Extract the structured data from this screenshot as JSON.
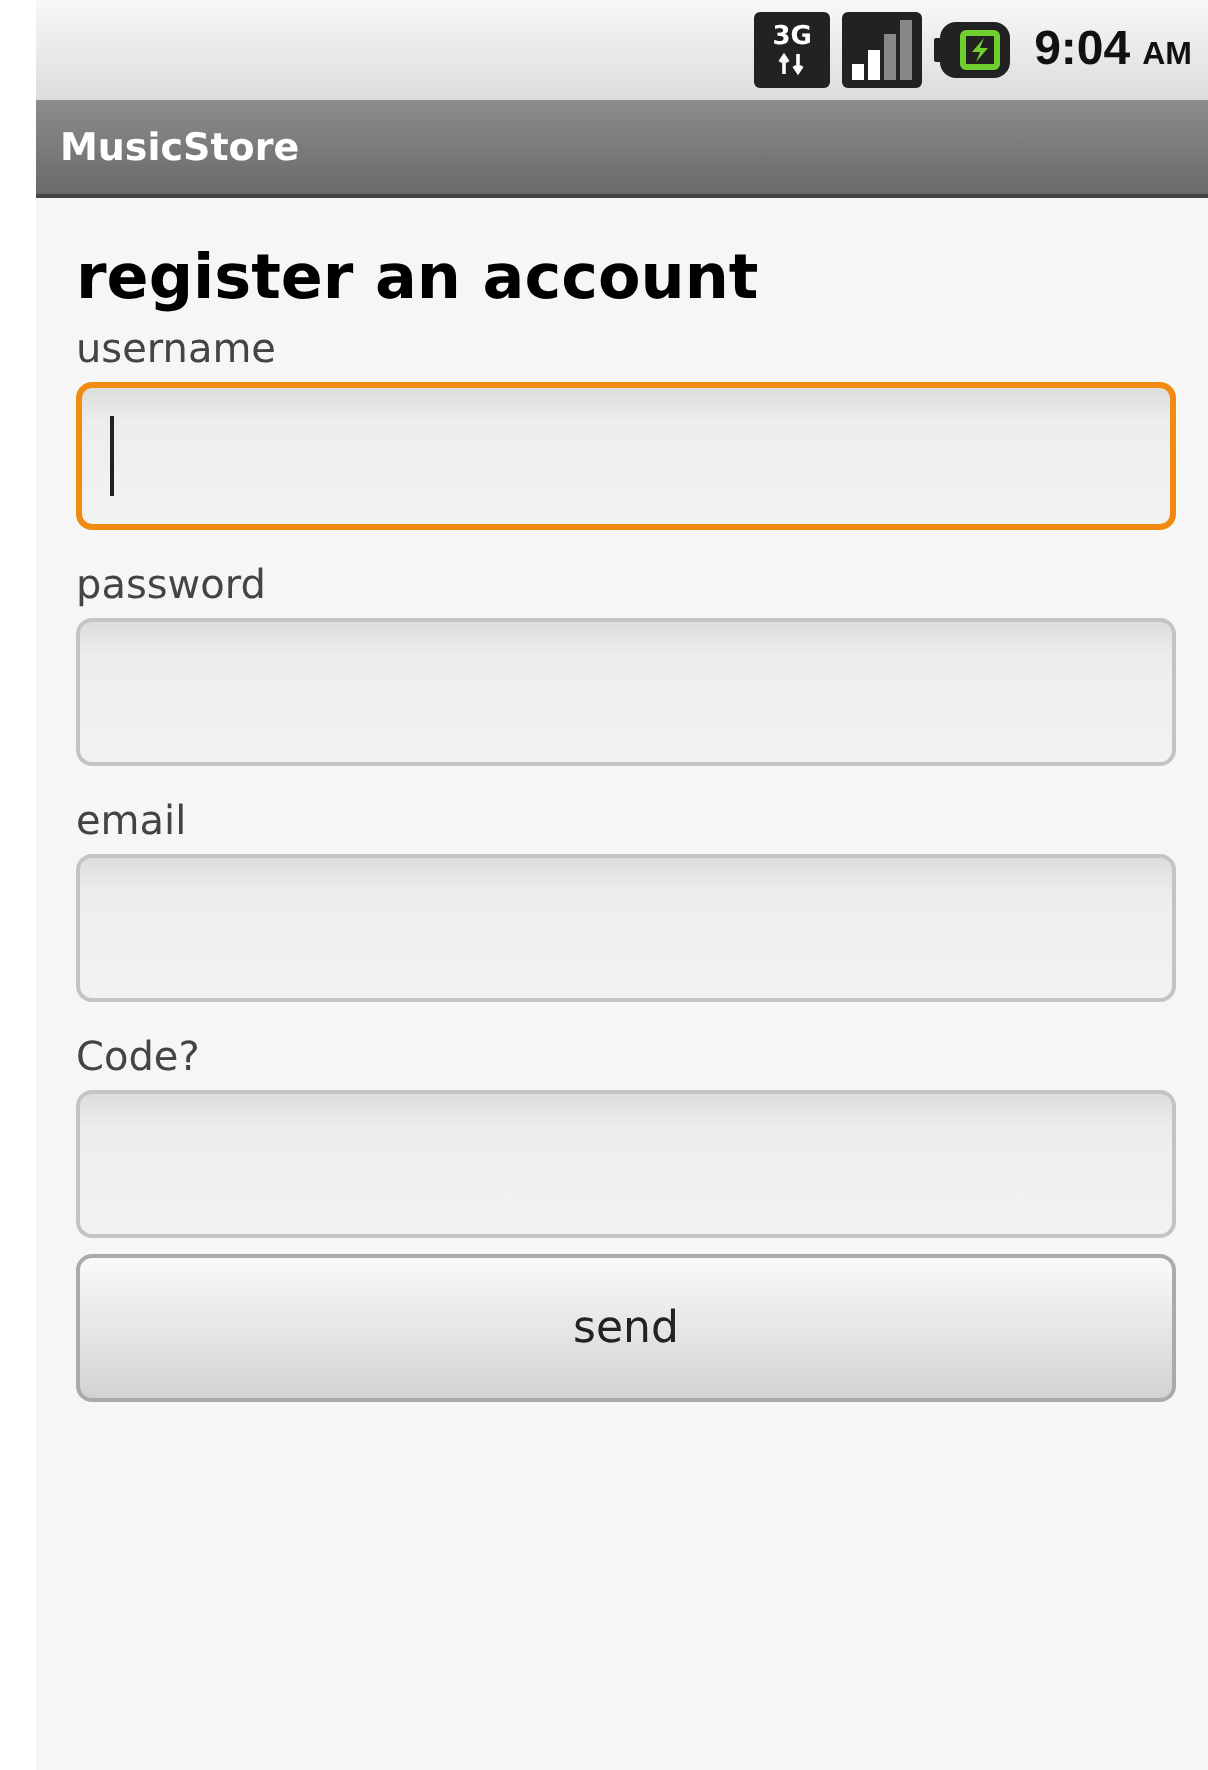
{
  "status_bar": {
    "network": "3G",
    "time": "9:04",
    "meridiem": "AM"
  },
  "app_bar": {
    "title": "MusicStore"
  },
  "heading": "register an account",
  "fields": [
    {
      "label": "username",
      "focused": true
    },
    {
      "label": "password",
      "focused": false
    },
    {
      "label": "email",
      "focused": false
    },
    {
      "label": "Code?",
      "focused": false
    }
  ],
  "button": {
    "label": "send"
  }
}
